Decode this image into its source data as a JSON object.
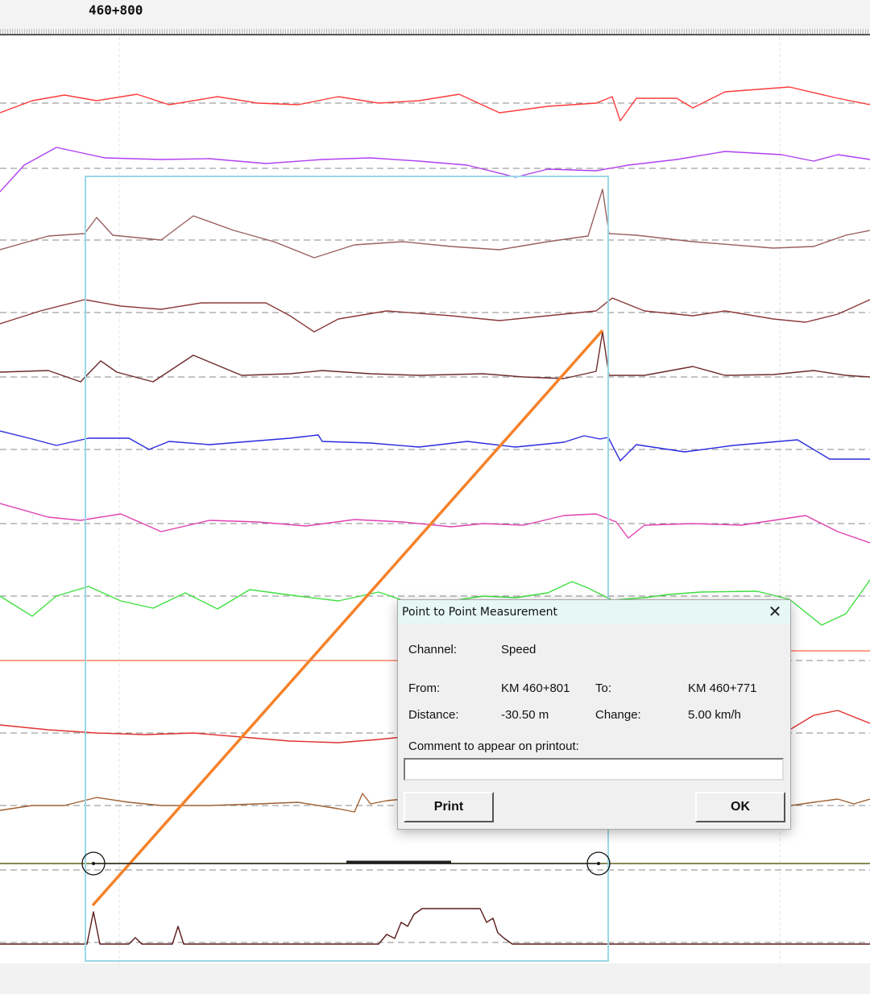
{
  "ruler": {
    "km_label": "460+800"
  },
  "dialog": {
    "title": "Point to Point Measurement",
    "close_icon": "close-icon",
    "channel_label": "Channel:",
    "channel_value": "Speed",
    "from_label": "From:",
    "from_value": "KM 460+801",
    "to_label": "To:",
    "to_value": "KM 460+771",
    "distance_label": "Distance:",
    "distance_value": "-30.50 m",
    "change_label": "Change:",
    "change_value": "5.00 km/h",
    "comment_label": "Comment to appear on printout:",
    "comment_value": "",
    "print_label": "Print",
    "ok_label": "OK"
  },
  "traces": [
    {
      "name": "trace-1",
      "color": "#ff3b3b"
    },
    {
      "name": "trace-2",
      "color": "#b040f0"
    },
    {
      "name": "trace-3",
      "color": "#9a6060"
    },
    {
      "name": "trace-4",
      "color": "#8b3a3a"
    },
    {
      "name": "trace-5",
      "color": "#6e2a2a"
    },
    {
      "name": "trace-6",
      "color": "#2a2ae0"
    },
    {
      "name": "trace-7",
      "color": "#e040b0"
    },
    {
      "name": "trace-8",
      "color": "#40e040"
    },
    {
      "name": "trace-9",
      "color": "#ff8060"
    },
    {
      "name": "trace-10",
      "color": "#e03030"
    },
    {
      "name": "trace-11",
      "color": "#a06030"
    },
    {
      "name": "trace-12",
      "color": "#606020"
    },
    {
      "name": "trace-13",
      "color": "#5a1a1a"
    }
  ],
  "measurement": {
    "line_color": "#f5822a",
    "box_color": "#9ad8e6"
  }
}
